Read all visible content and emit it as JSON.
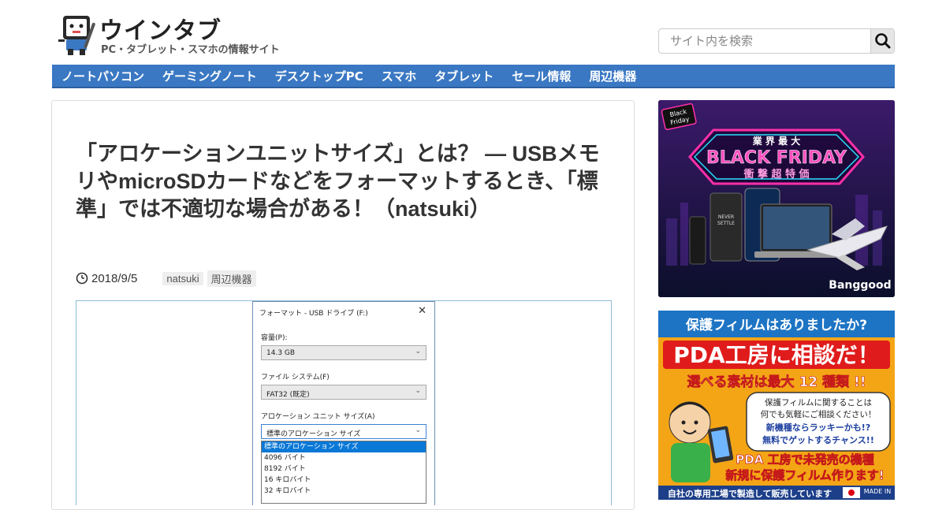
{
  "site": {
    "title": "ウインタブ",
    "subtitle": "PC・タブレット・スマホの情報サイト"
  },
  "search": {
    "placeholder": "サイト内を検索"
  },
  "nav": {
    "items": [
      "ノートパソコン",
      "ゲーミングノート",
      "デスクトップPC",
      "スマホ",
      "タブレット",
      "セール情報",
      "周辺機器"
    ]
  },
  "article": {
    "title": "「アロケーションユニットサイズ」とは？ — USBメモリやmicroSDカードなどをフォーマットするとき、「標準」では不適切な場合がある！（natsuki）",
    "date": "2018/9/5",
    "tags": [
      "natsuki",
      "周辺機器"
    ]
  },
  "dialog": {
    "title": "フォーマット - USB ドライブ (F:)",
    "close": "✕",
    "capacity_label": "容量(P):",
    "capacity_value": "14.3 GB",
    "fs_label": "ファイル システム(F)",
    "fs_value": "FAT32 (既定)",
    "alloc_label": "アロケーション ユニット サイズ(A)",
    "alloc_value": "標準のアロケーション サイズ",
    "options": [
      "標準のアロケーション サイズ",
      "4096 バイト",
      "8192 バイト",
      "16 キロバイト",
      "32 キロバイト"
    ]
  },
  "ad1": {
    "badge_line1": "Black",
    "badge_line2": "Friday",
    "line1": "業 界 最 大",
    "line2": "BLACK FRIDAY",
    "line3": "衝 撃 超 特 価",
    "brand": "Banggood",
    "phone_text1": "NEVER",
    "phone_text2": "SETTLE"
  },
  "ad2": {
    "line1": "保護フィルムはありましたか?",
    "line2": "PDA工房に相談だ！",
    "line3": "選べる素材は最大 12 種類 !!",
    "bubble1": "保護フィルムに関することは",
    "bubble2": "何でも気軽にご相談ください！",
    "bubble3": "新機種ならラッキーかも!?",
    "bubble4": "無料でゲットするチャンス!!",
    "line4": "PDA 工房で未発売の機種",
    "line5": "新規に保護フィルム作ります!",
    "line6": "自社の専用工場で製造して販売しています",
    "made_in": "MADE IN"
  }
}
